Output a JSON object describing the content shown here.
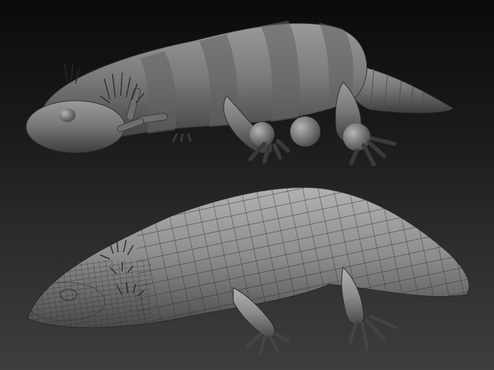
{
  "scene": {
    "background_top": "#0b0b0b",
    "background_bottom": "#3e3e3e",
    "subjects": [
      {
        "name": "segmented-base-mesh-axolotl",
        "material": "#7a7a7a",
        "wireframe": false
      },
      {
        "name": "quad-topology-axolotl",
        "material": "#8a8a8a",
        "wireframe": true,
        "wire_color": "#2a2a2a"
      }
    ]
  }
}
